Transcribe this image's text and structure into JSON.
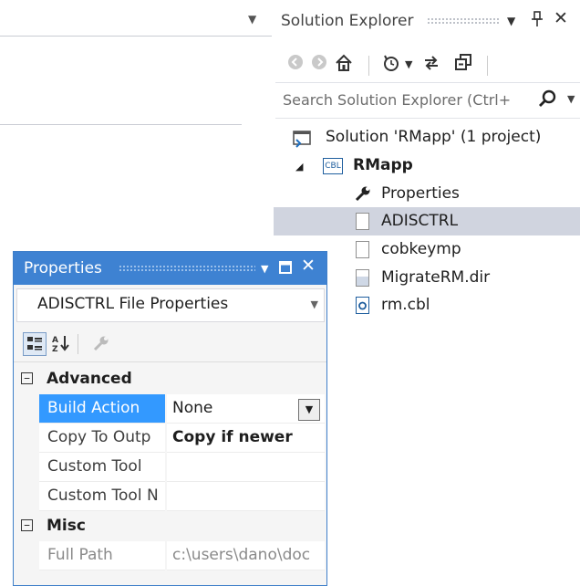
{
  "solution_explorer": {
    "title": "Solution Explorer",
    "controls": {
      "dropdown": "▼",
      "pin": "📌",
      "close": "✕"
    },
    "toolbar": [
      "back-icon",
      "forward-icon",
      "home-icon",
      "history-icon",
      "sync-icon",
      "collapse-all-icon"
    ],
    "search_placeholder": "Search Solution Explorer (Ctrl+",
    "tree": [
      {
        "label": "Solution 'RMapp' (1 project)",
        "icon": "solution-icon"
      },
      {
        "label": "RMapp",
        "icon": "cobol-project-icon",
        "bold": true
      },
      {
        "label": "Properties",
        "icon": "wrench-icon"
      },
      {
        "label": "ADISCTRL",
        "icon": "file-icon",
        "selected": true
      },
      {
        "label": "cobkeymp",
        "icon": "file-icon"
      },
      {
        "label": "MigrateRM.dir",
        "icon": "dir-file-icon"
      },
      {
        "label": "rm.cbl",
        "icon": "cobol-file-icon"
      }
    ],
    "project_badge": "CBL"
  },
  "properties": {
    "title": "Properties",
    "object_selector": "ADISCTRL File Properties",
    "categories": [
      {
        "name": "Advanced",
        "rows": [
          {
            "name": "Build Action",
            "value": "None",
            "selected": true
          },
          {
            "name": "Copy To Outp",
            "value": "Copy if newer",
            "bold": true
          },
          {
            "name": "Custom Tool",
            "value": ""
          },
          {
            "name": "Custom Tool N",
            "value": ""
          }
        ]
      },
      {
        "name": "Misc",
        "rows": [
          {
            "name": "Full Path",
            "value": "c:\\users\\dano\\doc",
            "readonly": true
          }
        ]
      }
    ],
    "expander": "⊟"
  },
  "colors": {
    "accent": "#3e82d2",
    "selection": "#3399ff",
    "tree_selection": "#d0d4df"
  }
}
